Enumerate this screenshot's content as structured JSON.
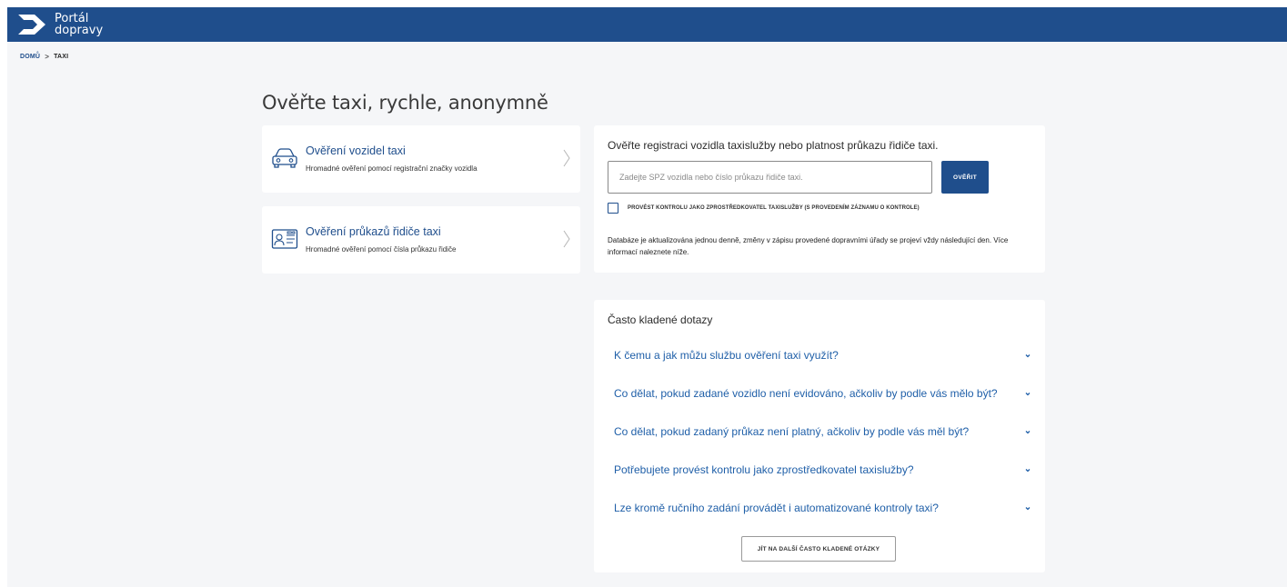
{
  "header": {
    "logo_line1": "Portál",
    "logo_line2": "dopravy",
    "logo_icon": "logo-arrow-icon"
  },
  "breadcrumb": {
    "home": "DOMŮ",
    "separator": ">",
    "current": "TAXI"
  },
  "page": {
    "title": "Ověřte taxi, rychle, anonymně"
  },
  "cards": [
    {
      "title": "Ověření vozidel taxi",
      "description": "Hromadné ověření pomocí registrační značky vozidla",
      "icon": "car-icon"
    },
    {
      "title": "Ověření průkazů řidiče taxi",
      "description": "Hromadné ověření pomocí čísla průkazu řidiče",
      "icon": "id-card-icon"
    }
  ],
  "verify": {
    "title": "Ověřte registraci vozidla taxislužby nebo platnost průkazu řidiče taxi.",
    "input_value": "",
    "input_placeholder": "Zadejte SPZ vozidla nebo číslo průkazu řidiče taxi.",
    "button_label": "OVĚŘIT",
    "checkbox_label": "PROVÉST KONTROLU JAKO ZPROSTŘEDKOVATEL TAXISLUŽBY (S PROVEDENÍM ZÁZNAMU O KONTROLE)",
    "checkbox_checked": false,
    "note": "Databáze je aktualizována jednou denně, změny v zápisu provedené dopravními úřady se projeví vždy následující den. Více informací naleznete níže."
  },
  "faq": {
    "title": "Často kladené dotazy",
    "items": [
      {
        "question": "K čemu a jak můžu službu ověření taxi využít?"
      },
      {
        "question": "Co dělat, pokud zadané vozidlo není evidováno, ačkoliv by podle vás mělo být?"
      },
      {
        "question": "Co dělat, pokud zadaný průkaz není platný, ačkoliv by podle vás měl být?"
      },
      {
        "question": "Potřebujete provést kontrolu jako zprostředkovatel taxislužby?"
      },
      {
        "question": "Lze kromě ručního zadání provádět i automatizované kontroly taxi?"
      }
    ],
    "more_button": "JÍT NA DALŠÍ ČASTO KLADENÉ OTÁZKY"
  },
  "colors": {
    "brand": "#1f4e8c",
    "link": "#1f5fa8",
    "background": "#f5f6f8"
  }
}
